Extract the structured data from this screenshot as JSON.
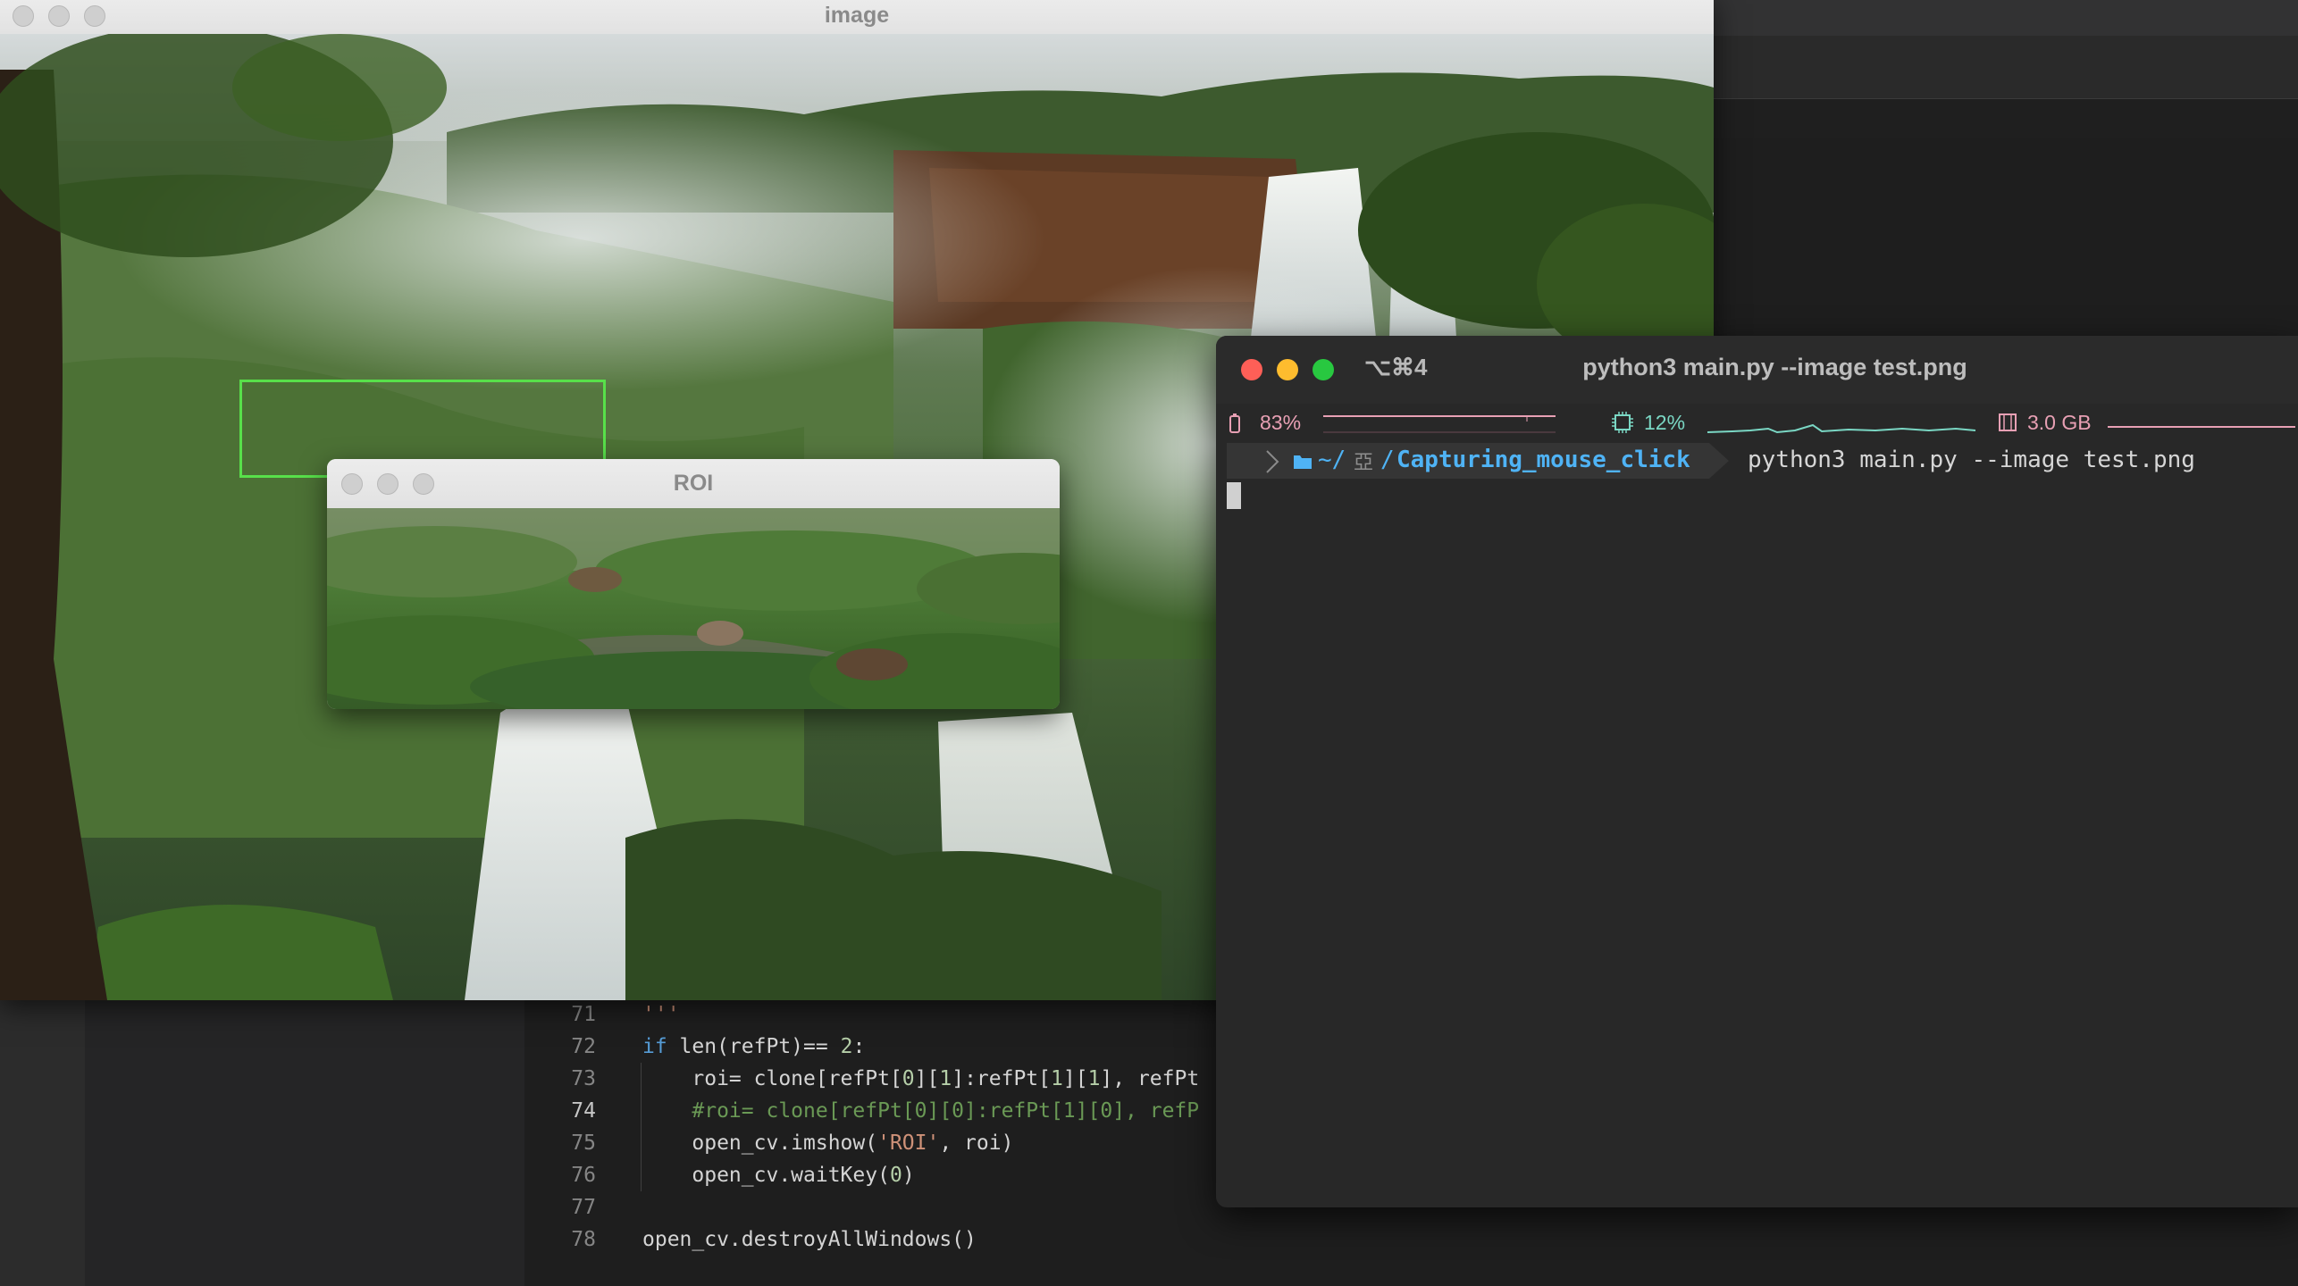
{
  "image_window": {
    "title": "image"
  },
  "roi_window": {
    "title": "ROI"
  },
  "terminal": {
    "shortcut": "⌥⌘4",
    "title": "python3 main.py --image test.png",
    "status": {
      "battery": "83%",
      "cpu": "12%",
      "memory": "3.0 GB"
    },
    "prompt": {
      "apple_glyph": "",
      "path_prefix": "~/",
      "path_mid_glyph": "亞",
      "path_sep": "/",
      "directory": "Capturing_mouse_click",
      "command": "python3 main.py --image test.png"
    },
    "colors": {
      "close": "#fe5f57",
      "minimize": "#febc2e",
      "maximize": "#28c840",
      "battery": "#e8a0b4",
      "cpu": "#7ad7c4",
      "memory": "#e8a0b4",
      "directory": "#4fb3f5"
    }
  },
  "code": {
    "lines": [
      {
        "n": "71",
        "parts": [
          {
            "t": "'''",
            "c": "str"
          }
        ]
      },
      {
        "n": "72",
        "parts": [
          {
            "t": "if",
            "c": "kw"
          },
          {
            "t": " len(refPt)== ",
            "c": ""
          },
          {
            "t": "2",
            "c": "num"
          },
          {
            "t": ":",
            "c": ""
          }
        ]
      },
      {
        "n": "73",
        "parts": [
          {
            "t": "    roi= clone[refPt[",
            "c": ""
          },
          {
            "t": "0",
            "c": "num"
          },
          {
            "t": "][",
            "c": ""
          },
          {
            "t": "1",
            "c": "num"
          },
          {
            "t": "]:refPt[",
            "c": ""
          },
          {
            "t": "1",
            "c": "num"
          },
          {
            "t": "][",
            "c": ""
          },
          {
            "t": "1",
            "c": "num"
          },
          {
            "t": "], refPt",
            "c": ""
          }
        ]
      },
      {
        "n": "74",
        "active": true,
        "parts": [
          {
            "t": "    #roi= clone[refPt[0][0]:refPt[1][0], refP",
            "c": "cmt"
          }
        ]
      },
      {
        "n": "75",
        "parts": [
          {
            "t": "    open_cv.imshow(",
            "c": ""
          },
          {
            "t": "'ROI'",
            "c": "str"
          },
          {
            "t": ", roi)",
            "c": ""
          }
        ]
      },
      {
        "n": "76",
        "parts": [
          {
            "t": "    open_cv.waitKey(",
            "c": ""
          },
          {
            "t": "0",
            "c": "num"
          },
          {
            "t": ")",
            "c": ""
          }
        ]
      },
      {
        "n": "77",
        "parts": []
      },
      {
        "n": "78",
        "parts": [
          {
            "t": "open_cv.destroyAllWindows()",
            "c": ""
          }
        ]
      }
    ]
  }
}
